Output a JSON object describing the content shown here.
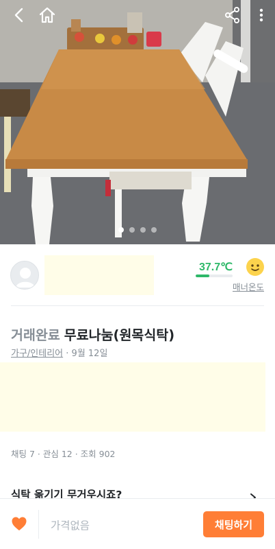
{
  "header": {
    "back_icon": "chevron-left-icon",
    "home_icon": "home-icon",
    "share_icon": "share-icon",
    "more_icon": "more-vertical-icon"
  },
  "photo": {
    "subject": "photo",
    "page_indicator": {
      "count": 4,
      "active_index": 0
    }
  },
  "seller": {
    "avatar_icon": "default-avatar-icon",
    "nickname": "",
    "manner_temperature": "37.7℃",
    "manner_temperature_value": 37.7,
    "manner_label": "매너온도",
    "temperature_color": "#2eb869"
  },
  "article": {
    "status": "거래완료",
    "title": "무료나눔(원목식탁)",
    "category": "가구/인테리어",
    "date": "9월 12일",
    "description": "",
    "stats": "채팅 7 · 관심 12 · 조회 902"
  },
  "promo": {
    "text": "식탁 옮기기 무거우시죠?"
  },
  "bottom_bar": {
    "heart_icon": "heart-icon",
    "price": "가격없음",
    "chat_button": "채팅하기",
    "accent_color": "#ff7e36"
  }
}
